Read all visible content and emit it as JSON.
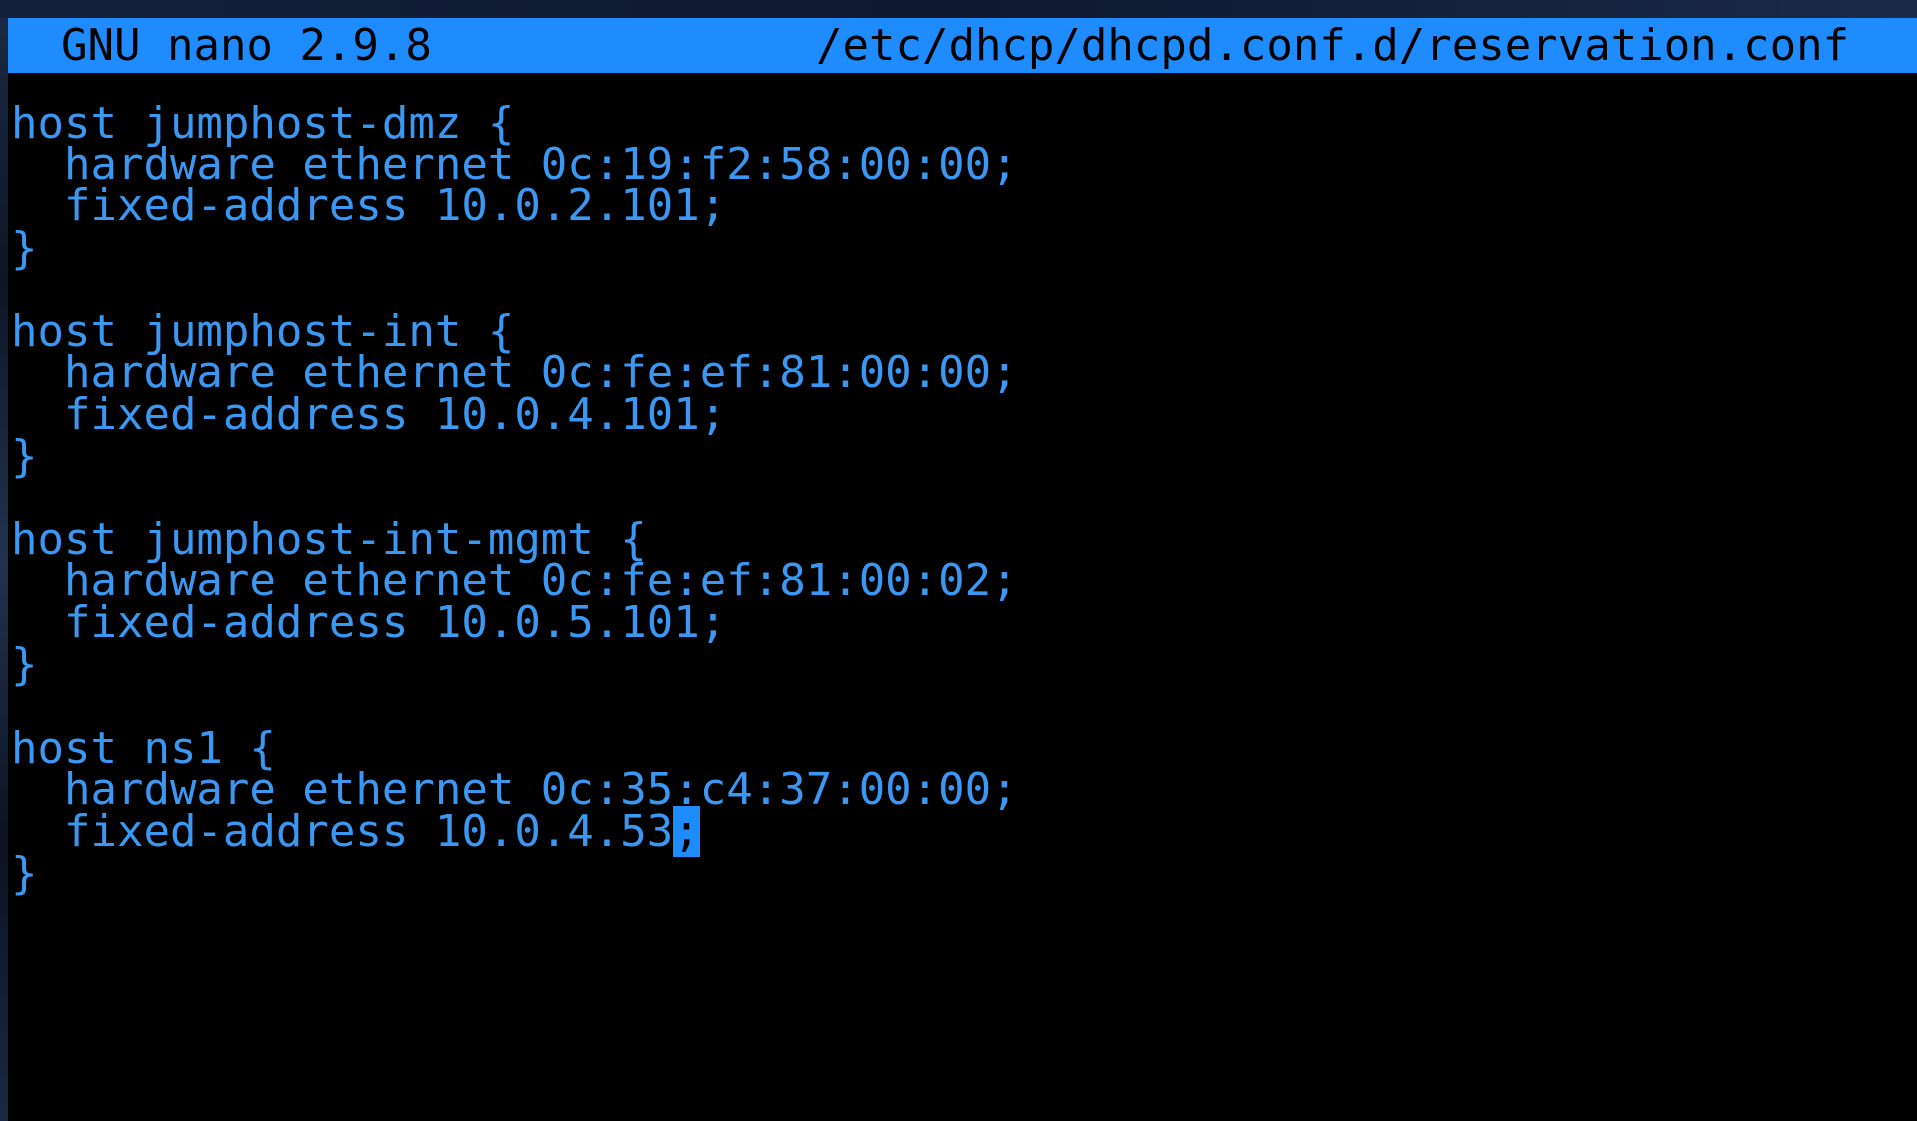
{
  "titlebar": {
    "app_version": "GNU nano 2.9.8",
    "file_path": "/etc/dhcp/dhcpd.conf.d/reservation.conf",
    "background_color": "#1e8cff"
  },
  "editor": {
    "text_color": "#3b98f2",
    "cursor_color": "#1e8cff",
    "lines": [
      "",
      "host jumphost-dmz {",
      "  hardware ethernet 0c:19:f2:58:00:00;",
      "  fixed-address 10.0.2.101;",
      "}",
      "",
      "host jumphost-int {",
      "  hardware ethernet 0c:fe:ef:81:00:00;",
      "  fixed-address 10.0.4.101;",
      "}",
      "",
      "host jumphost-int-mgmt {",
      "  hardware ethernet 0c:fe:ef:81:00:02;",
      "  fixed-address 10.0.5.101;",
      "}",
      "",
      "host ns1 {",
      "  hardware ethernet 0c:35:c4:37:00:00;",
      "  fixed-address 10.0.4.53",
      "}"
    ],
    "cursor_char": ";"
  }
}
